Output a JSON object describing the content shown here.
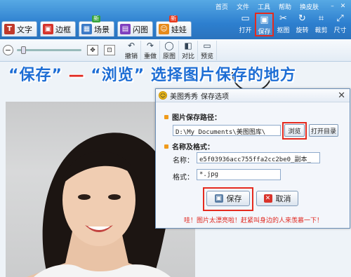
{
  "menu": {
    "items": [
      "首页",
      "文件",
      "工具",
      "帮助",
      "换皮肤"
    ],
    "minimize": "–",
    "close": "✕"
  },
  "tabs": [
    {
      "label": "文字",
      "icon": "text-icon",
      "glyph": "T",
      "color": "#c0392b",
      "badge": ""
    },
    {
      "label": "边框",
      "icon": "frame-icon",
      "glyph": "▣",
      "color": "#d6332a",
      "badge": ""
    },
    {
      "label": "场景",
      "icon": "scene-icon",
      "glyph": "▦",
      "color": "#3b7ac7",
      "badge": "新"
    },
    {
      "label": "闪图",
      "icon": "flash-icon",
      "glyph": "▤",
      "color": "#7f3fbf",
      "badge": ""
    },
    {
      "label": "娃娃",
      "icon": "doll-icon",
      "glyph": "☺",
      "color": "#e68a1a",
      "badge": "新"
    }
  ],
  "tools": [
    {
      "label": "打开",
      "icon": "open-folder-icon",
      "glyph": "📂"
    },
    {
      "label": "保存",
      "icon": "save-icon",
      "glyph": "💾"
    },
    {
      "label": "抠图",
      "icon": "cutout-icon",
      "glyph": "✂"
    },
    {
      "label": "旋转",
      "icon": "rotate-icon",
      "glyph": "↻"
    },
    {
      "label": "裁剪",
      "icon": "crop-icon",
      "glyph": "⌗"
    },
    {
      "label": "尺寸",
      "icon": "resize-icon",
      "glyph": "⤢"
    }
  ],
  "subtools": [
    {
      "label": "撤销",
      "icon": "undo-icon",
      "glyph": "↶"
    },
    {
      "label": "重做",
      "icon": "redo-icon",
      "glyph": "↷"
    },
    {
      "label": "原图",
      "icon": "original-icon",
      "glyph": "◯"
    },
    {
      "label": "对比",
      "icon": "compare-icon",
      "glyph": "◧"
    },
    {
      "label": "预览",
      "icon": "preview-icon",
      "glyph": "▭"
    }
  ],
  "annotation": {
    "part1": "“保存”",
    "dash": " — ",
    "part2": "“浏览”",
    "part3": " 选择图片保存的地方"
  },
  "dialog": {
    "app": "美图秀秀",
    "title": "保存选项",
    "path_section": "图片保存路径：",
    "path_value": "D:\\My Documents\\美图图库\\",
    "browse": "浏览",
    "open_dir": "打开目录",
    "name_section": "名称及格式：",
    "name_label": "名称：",
    "name_value": "e5f03936acc755ffa2cc2be0_副本_",
    "format_label": "格式：",
    "format_value": "*.jpg",
    "save": "保存",
    "cancel": "取消",
    "tip": "哇！图片太漂亮啦！赶紧叫身边的人来羡慕一下！",
    "close": "✕"
  },
  "colors": {
    "accent_red": "#e52a1e",
    "title_blue": "#1d6dd4"
  }
}
